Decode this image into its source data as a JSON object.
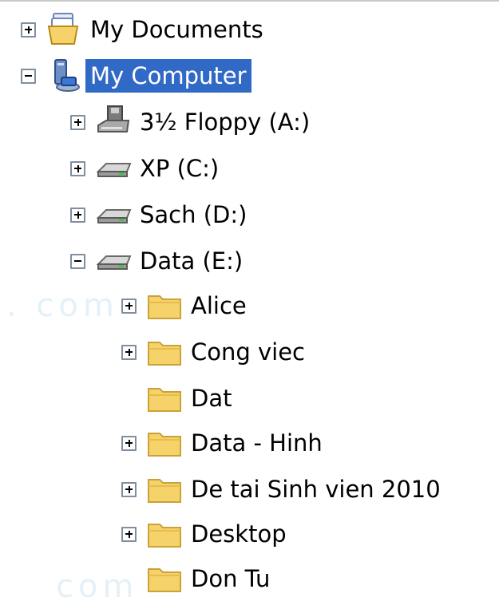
{
  "tree": {
    "items": [
      {
        "label": "My Documents",
        "expander": "plus",
        "icon": "my-documents-icon",
        "selected": false
      },
      {
        "label": "My Computer",
        "expander": "minus",
        "icon": "my-computer-icon",
        "selected": true
      },
      {
        "label": "3½ Floppy (A:)",
        "expander": "plus",
        "icon": "floppy-drive-icon",
        "selected": false
      },
      {
        "label": "XP (C:)",
        "expander": "plus",
        "icon": "hard-drive-icon",
        "selected": false
      },
      {
        "label": "Sach (D:)",
        "expander": "plus",
        "icon": "hard-drive-icon",
        "selected": false
      },
      {
        "label": "Data (E:)",
        "expander": "minus",
        "icon": "hard-drive-icon",
        "selected": false
      },
      {
        "label": "Alice",
        "expander": "plus",
        "icon": "folder-icon",
        "selected": false
      },
      {
        "label": "Cong viec",
        "expander": "plus",
        "icon": "folder-icon",
        "selected": false
      },
      {
        "label": "Dat",
        "expander": "none",
        "icon": "folder-icon",
        "selected": false
      },
      {
        "label": "Data - Hinh",
        "expander": "plus",
        "icon": "folder-icon",
        "selected": false
      },
      {
        "label": "De tai Sinh vien 2010",
        "expander": "plus",
        "icon": "folder-icon",
        "selected": false
      },
      {
        "label": "Desktop",
        "expander": "plus",
        "icon": "folder-icon",
        "selected": false
      },
      {
        "label": "Don Tu",
        "expander": "none",
        "icon": "folder-icon",
        "selected": false
      }
    ]
  },
  "colors": {
    "selection": "#3169c6",
    "expander_border": "#7f8ea0",
    "folder": "#f6d36a"
  }
}
